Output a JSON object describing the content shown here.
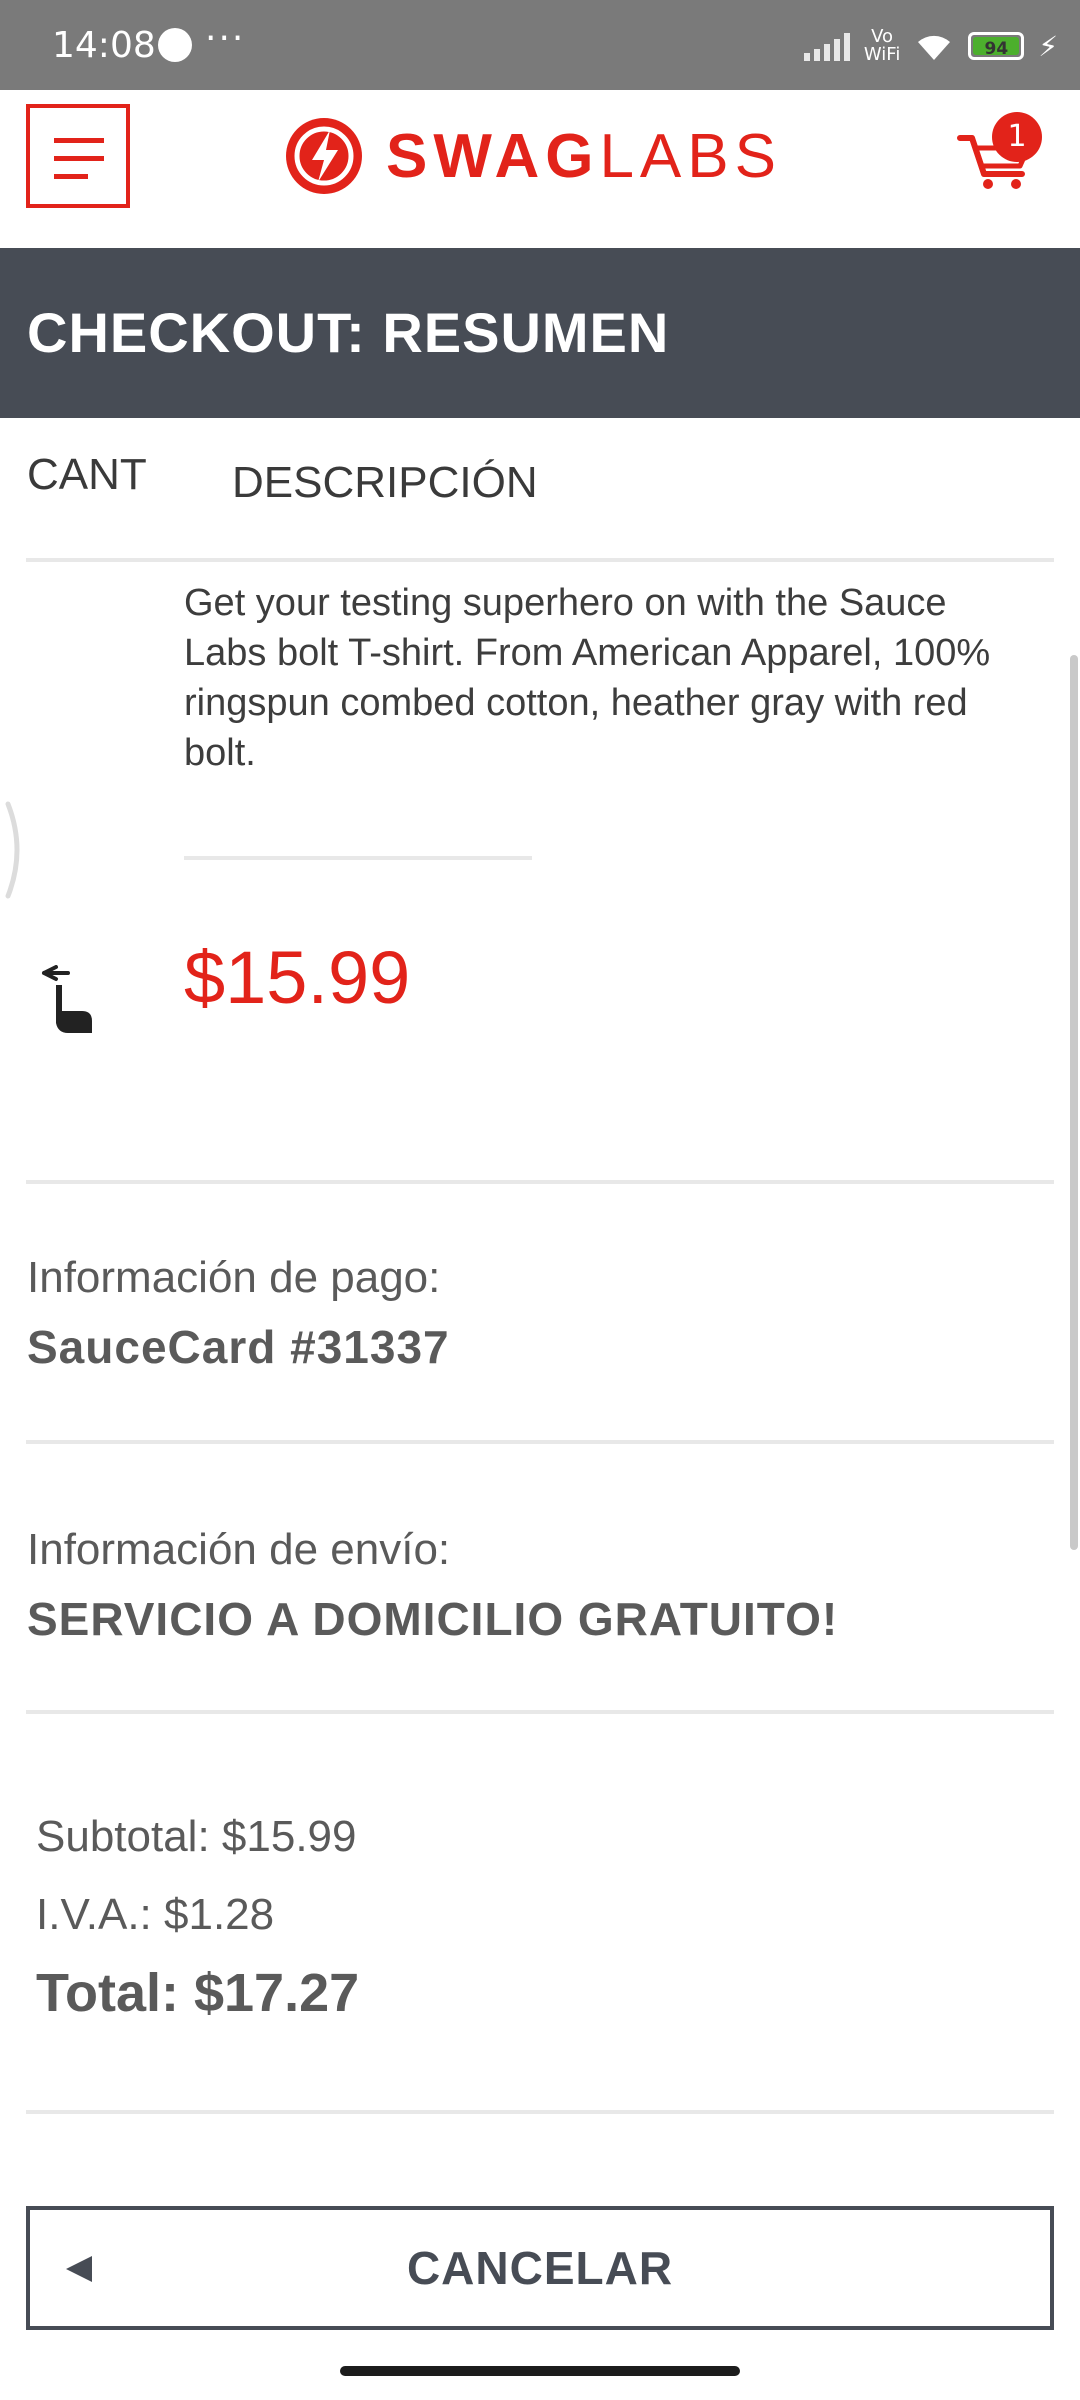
{
  "status": {
    "time": "14:08",
    "dots": "···",
    "vowifi_top": "Vo",
    "vowifi_bottom": "WiFi",
    "battery": "94"
  },
  "header": {
    "logo_bold": "SWAG",
    "logo_light": "LABS",
    "cart_count": "1"
  },
  "title": "CHECKOUT: RESUMEN",
  "columns": {
    "qty": "CANT",
    "desc": "DESCRIPCIÓN"
  },
  "item": {
    "description": "Get your testing superhero on with the Sauce Labs bolt T-shirt. From American Apparel, 100% ringspun combed cotton, heather gray with red bolt.",
    "price": "$15.99"
  },
  "payment": {
    "label": "Información de pago:",
    "value": "SauceCard #31337"
  },
  "shipping": {
    "label": "Información de envío:",
    "value": "SERVICIO A DOMICILIO GRATUITO!"
  },
  "summary": {
    "subtotal": "Subtotal: $15.99",
    "tax": "I.V.A.: $1.28",
    "total": "Total: $17.27"
  },
  "buttons": {
    "cancel": "CANCELAR"
  },
  "colors": {
    "brand_red": "#e2231a",
    "header_dark": "#474c55",
    "statusbar": "#7a7a7a"
  }
}
